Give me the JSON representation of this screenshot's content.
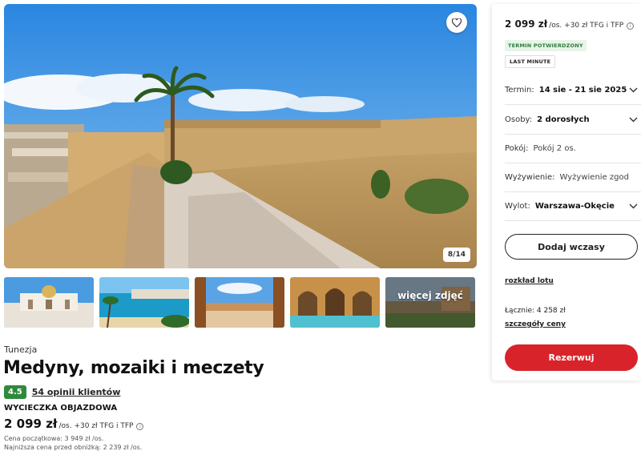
{
  "gallery": {
    "counter": "8/14",
    "more_photos": "więcej zdjęć",
    "favorite_icon": "heart-icon"
  },
  "offer": {
    "country": "Tunezja",
    "title": "Medyny, mozaiki i meczety",
    "rating": "4.5",
    "reviews": "54 opinii klientów",
    "trip_type": "WYCIECZKA OBJAZDOWA",
    "price": "2 099 zł",
    "price_suffix": "/os. +30 zł TFG i TFP",
    "initial_price": "Cena początkowa: 3 949 zł /os.",
    "lowest_price": "Najniższa cena przed obniżką: 2 239 zł /os."
  },
  "panel": {
    "price": "2 099 zł",
    "price_suffix": "/os. +30 zł TFG i TFP",
    "badge_confirmed": "TERMIN POTWIERDZONY",
    "badge_last_minute": "LAST MINUTE",
    "term_label": "Termin:",
    "term_value": "14 sie - 21 sie 2025",
    "persons_label": "Osoby:",
    "persons_value": "2 dorosłych",
    "room_label": "Pokój:",
    "room_value": "Pokój 2 os.",
    "board_label": "Wyżywienie:",
    "board_value": "Wyżywienie zgodnie z programem",
    "departure_label": "Wylot:",
    "departure_value": "Warszawa-Okęcie",
    "add_button": "Dodaj wczasy",
    "flight_schedule": "rozkład lotu",
    "total": "Łącznie: 4 258 zł",
    "price_details": "szczegóły ceny",
    "reserve_button": "Rezerwuj"
  },
  "colors": {
    "reserve": "#d9232b",
    "rating_badge": "#2f8a3b",
    "confirmed_badge": "#2f7a3a"
  }
}
